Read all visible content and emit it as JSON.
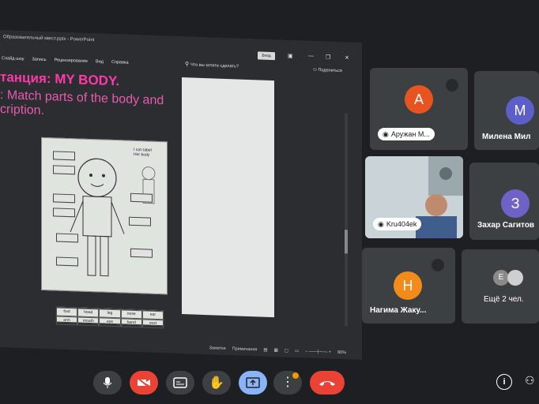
{
  "presentation": {
    "window_title": "Образовательный квест.pptx - PowerPoint",
    "login_button": "Вход",
    "ribbon_tabs": [
      "Слайд-шоу",
      "Запись",
      "Рецензирование",
      "Вид",
      "Справка"
    ],
    "tell_me": "Что вы хотите сделать?",
    "share": "Поделиться",
    "slide": {
      "heading": "танция: MY BODY.",
      "subtitle_line1": ": Match parts of the body and",
      "subtitle_line2": "cription.",
      "worksheet_caption_line1": "I can label",
      "worksheet_caption_line2": "Her body",
      "word_bank": [
        "foot",
        "head",
        "leg",
        "nose",
        "ear",
        "arm",
        "mouth",
        "eye",
        "hand",
        "vest"
      ]
    },
    "status_bar": {
      "notes": "Заметки",
      "comments": "Примечания",
      "zoom": "80%"
    }
  },
  "participants": [
    {
      "name": "Аружан М...",
      "initial": "A",
      "color": "#e8541f",
      "muted": true
    },
    {
      "name": "Милена Мил",
      "initial": "M",
      "color": "#5b5fc7",
      "muted": false
    },
    {
      "name": "Kru404ek",
      "initial": "",
      "color": "",
      "muted": true
    },
    {
      "name": "Захар Сагитов",
      "initial": "З",
      "color": "#6f62c6",
      "muted": false
    },
    {
      "name": "Нагима Жаку...",
      "initial": "H",
      "color": "#f28b1a",
      "muted": true
    },
    {
      "name": "Ещё 2 чел.",
      "initial": "E",
      "color": "#8a8a8a",
      "muted": false
    }
  ],
  "controls": {
    "buttons": [
      "mic",
      "camera-off",
      "captions",
      "raise-hand",
      "present",
      "more",
      "end-call"
    ],
    "colors": {
      "red": "#ea4335",
      "blue": "#8ab4f8",
      "dark": "#3c4043"
    }
  }
}
